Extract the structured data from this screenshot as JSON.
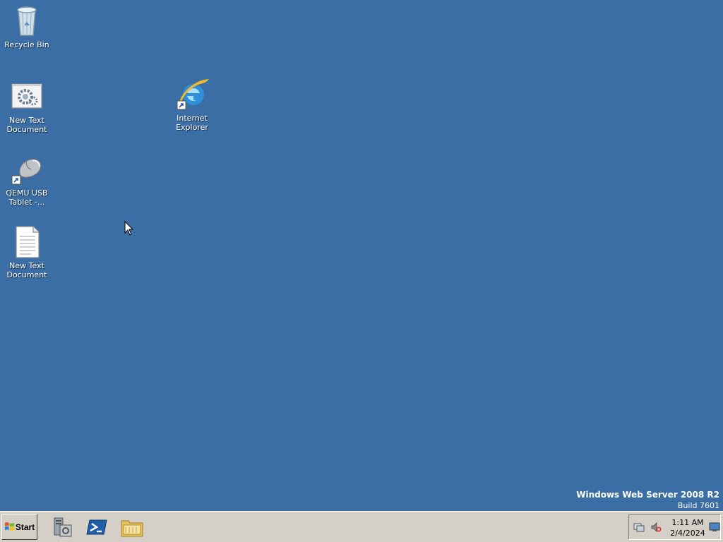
{
  "desktop": {
    "icons": [
      {
        "label": "Recycle Bin",
        "icon": "recycle-bin-icon"
      },
      {
        "label": "New Text Document",
        "icon": "settings-document-icon"
      },
      {
        "label": "Internet Explorer",
        "icon": "internet-explorer-icon"
      },
      {
        "label": "QEMU USB Tablet -...",
        "icon": "usb-tablet-icon"
      },
      {
        "label": "New Text Document",
        "icon": "text-document-icon"
      }
    ],
    "background_color": "#3a6ea5"
  },
  "watermark": {
    "title": "Windows Web Server 2008 R2",
    "build": "Build 7601"
  },
  "taskbar": {
    "start_label": "Start",
    "pinned": [
      {
        "name": "server-manager",
        "icon": "server-manager-icon"
      },
      {
        "name": "powershell",
        "icon": "powershell-icon"
      },
      {
        "name": "windows-explorer",
        "icon": "folder-icon"
      }
    ],
    "tray": {
      "icons": [
        "network-icon",
        "volume-muted-icon"
      ],
      "time": "1:11 AM",
      "date": "2/4/2024"
    }
  }
}
